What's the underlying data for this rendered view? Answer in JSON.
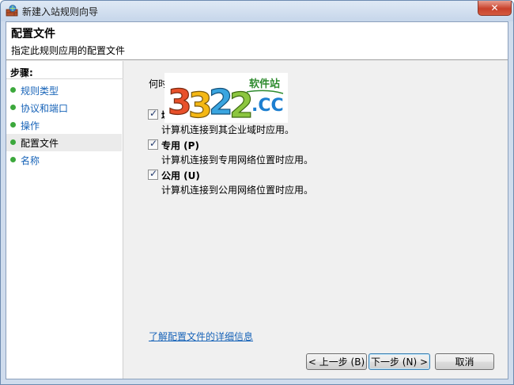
{
  "window": {
    "title": "新建入站规则向导",
    "close_label": "✕"
  },
  "header": {
    "title": "配置文件",
    "subtitle": "指定此规则应用的配置文件"
  },
  "sidebar": {
    "steps_label": "步骤:",
    "items": [
      {
        "label": "规则类型",
        "active": false
      },
      {
        "label": "协议和端口",
        "active": false
      },
      {
        "label": "操作",
        "active": false
      },
      {
        "label": "配置文件",
        "active": true
      },
      {
        "label": "名称",
        "active": false
      }
    ]
  },
  "main": {
    "question": "何时",
    "watermark": {
      "big": "3322",
      "small": "软件站",
      "suffix": ".CC"
    },
    "options": [
      {
        "label": "域",
        "checked": true,
        "description": "计算机连接到其企业域时应用。"
      },
      {
        "label": "专用 (P)",
        "checked": true,
        "description": "计算机连接到专用网络位置时应用。"
      },
      {
        "label": "公用 (U)",
        "checked": true,
        "description": "计算机连接到公用网络位置时应用。"
      }
    ],
    "learn_more": "了解配置文件的详细信息"
  },
  "buttons": {
    "back": "< 上一步 (B)",
    "next": "下一步 (N) >",
    "cancel": "取消"
  },
  "colors": {
    "link": "#1763b8",
    "step_dot": "#3ca83c",
    "close": "#c8412b"
  }
}
